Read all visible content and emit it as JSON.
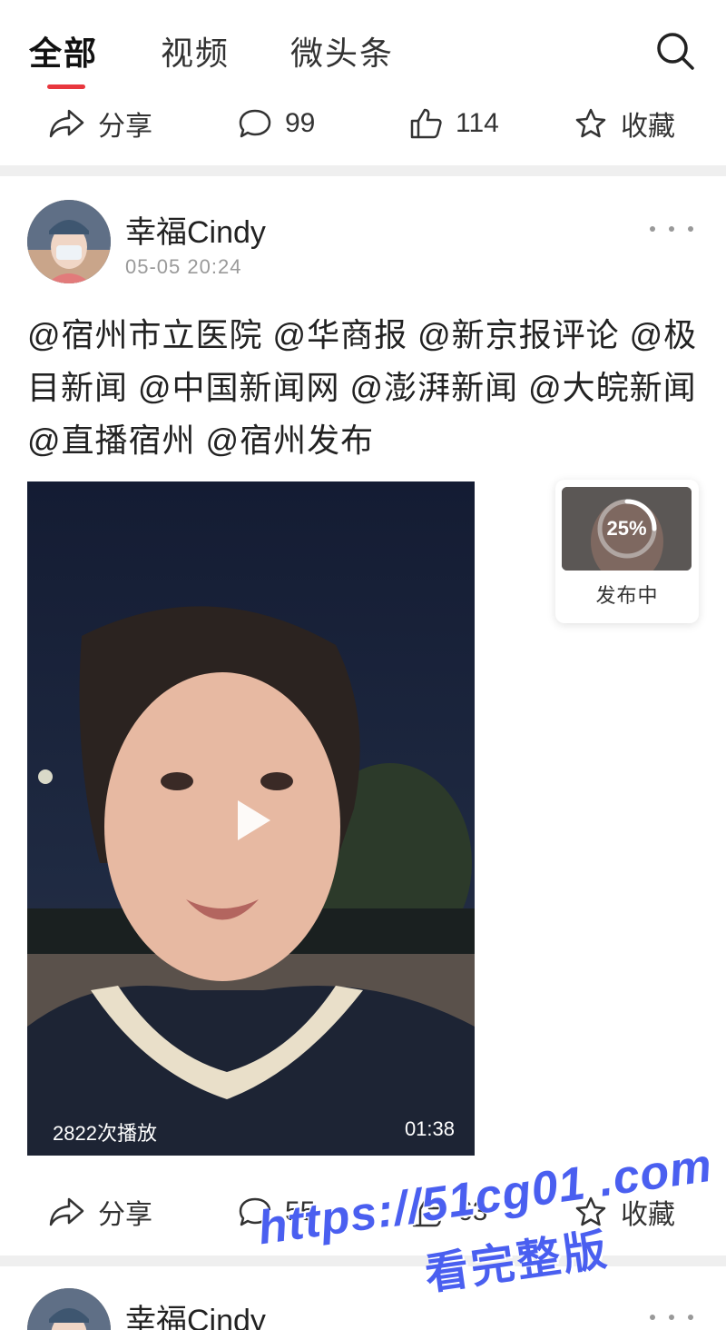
{
  "tabs": [
    {
      "label": "全部"
    },
    {
      "label": "视频"
    },
    {
      "label": "微头条"
    }
  ],
  "top_actions": {
    "share_label": "分享",
    "comment_count": "99",
    "like_count": "114",
    "favorite_label": "收藏"
  },
  "post": {
    "author": "幸福Cindy",
    "timestamp": "05-05 20:24",
    "text": "@宿州市立医院 @华商报 @新京报评论 @极目新闻 @中国新闻网 @澎湃新闻 @大皖新闻 @直播宿州 @宿州发布",
    "video": {
      "views": "2822次播放",
      "duration": "01:38"
    },
    "actions": {
      "share_label": "分享",
      "comment_count": "55",
      "like_count": "63",
      "favorite_label": "收藏"
    }
  },
  "publishing": {
    "progress": "25%",
    "progress_fraction": 0.25,
    "label": "发布中"
  },
  "next_post": {
    "author": "幸福Cindy"
  },
  "watermark": {
    "url": "https://51cg01 .com",
    "subtitle": "看完整版"
  },
  "colors": {
    "accent": "#e8373e",
    "watermark": "#4a5ff0",
    "divider": "#efefef"
  }
}
